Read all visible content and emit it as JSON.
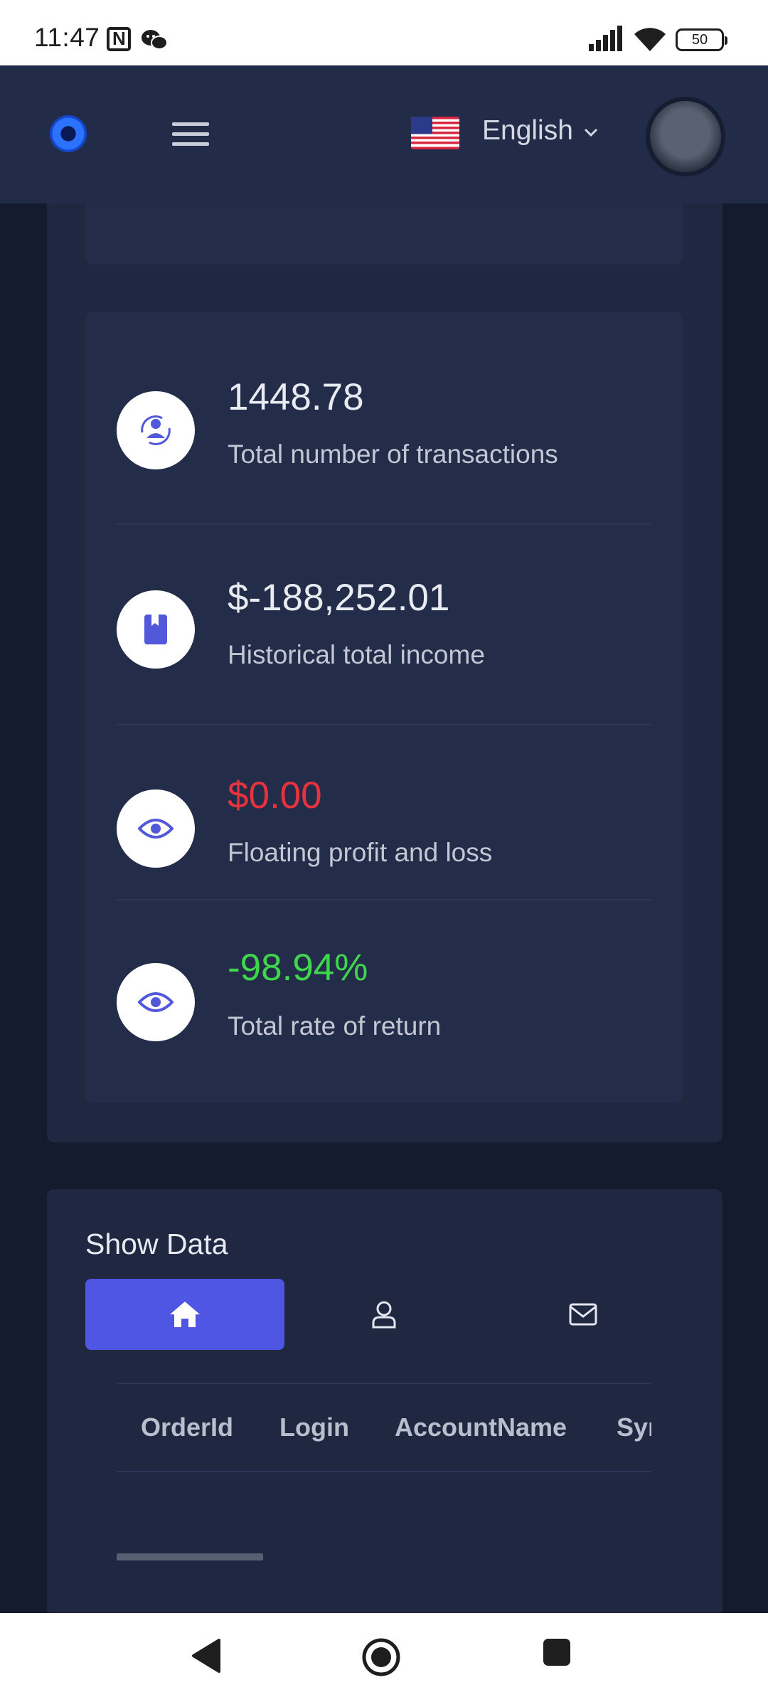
{
  "status_bar": {
    "time": "11:47",
    "battery": "50",
    "icons": [
      "nfc-icon",
      "wechat-icon",
      "signal-icon",
      "wifi-icon",
      "battery-icon"
    ]
  },
  "header": {
    "logo_icon": "brand-logo",
    "menu_icon": "hamburger-menu-icon",
    "language": "English",
    "flag_icon": "us-flag-icon",
    "avatar_icon": "user-avatar"
  },
  "stats": [
    {
      "value": "1448.78",
      "label": "Total number of transactions",
      "icon": "user-sync-icon",
      "tone": "neutral"
    },
    {
      "value": "$-188,252.01",
      "label": "Historical total income",
      "icon": "bookmark-icon",
      "tone": "neutral"
    },
    {
      "value": "$0.00",
      "label": "Floating profit and loss",
      "icon": "eye-icon",
      "tone": "negative"
    },
    {
      "value": "-98.94%",
      "label": "Total rate of return",
      "icon": "eye-icon",
      "tone": "positive"
    }
  ],
  "show_data": {
    "title": "Show Data",
    "tabs": [
      {
        "icon": "home-icon",
        "active": true
      },
      {
        "icon": "user-icon",
        "active": false
      },
      {
        "icon": "mail-icon",
        "active": false
      }
    ],
    "columns": [
      "OrderId",
      "Login",
      "AccountName",
      "Symbol"
    ]
  },
  "colors": {
    "background": "#151b2e",
    "card": "#232c48",
    "accent": "#4e56e3",
    "negative": "#e8333f",
    "positive": "#3fd64e"
  },
  "navigation": [
    "back-icon",
    "home-circle-icon",
    "recents-icon"
  ]
}
